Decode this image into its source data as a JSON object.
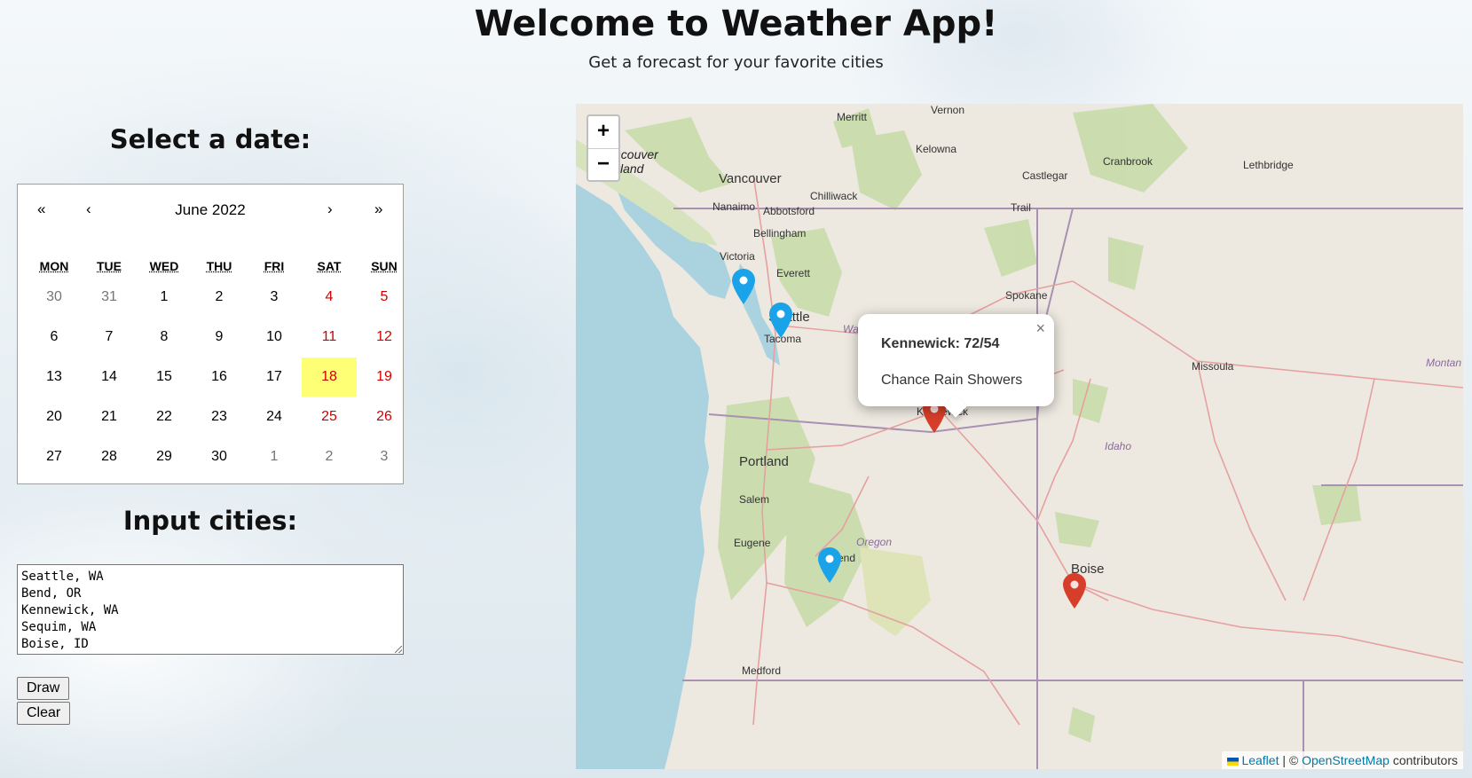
{
  "page": {
    "title": "Welcome to Weather App!",
    "subtitle": "Get a forecast for your favorite cities"
  },
  "date_section": {
    "heading": "Select a date:"
  },
  "calendar": {
    "nav_prev2": "«",
    "nav_prev": "‹",
    "nav_next": "›",
    "nav_next2": "»",
    "month_label": "June 2022",
    "weekdays": [
      "MON",
      "TUE",
      "WED",
      "THU",
      "FRI",
      "SAT",
      "SUN"
    ],
    "days": [
      [
        "30",
        "31",
        "1",
        "2",
        "3",
        "4",
        "5"
      ],
      [
        "6",
        "7",
        "8",
        "9",
        "10",
        "11",
        "12"
      ],
      [
        "13",
        "14",
        "15",
        "16",
        "17",
        "18",
        "19"
      ],
      [
        "20",
        "21",
        "22",
        "23",
        "24",
        "25",
        "26"
      ],
      [
        "27",
        "28",
        "29",
        "30",
        "1",
        "2",
        "3"
      ]
    ],
    "selected_day": "18",
    "selected_color": "#ffff76",
    "weekend_color": "#d10000"
  },
  "cities_section": {
    "heading": "Input cities:",
    "value": "Seattle, WA\nBend, OR\nKennewick, WA\nSequim, WA\nBoise, ID"
  },
  "buttons": {
    "draw": "Draw",
    "clear": "Clear"
  },
  "map": {
    "zoom_in": "+",
    "zoom_out": "−",
    "labels": {
      "vancouver_island": "ncouver\nsland",
      "vernon": "Vernon",
      "merritt": "Merritt",
      "kelowna": "Kelowna",
      "vancouver": "Vancouver",
      "nanaimo": "Nanaimo",
      "chilliwack": "Chilliwack",
      "abbotsford": "Abbotsford",
      "castlegar": "Castlegar",
      "trail": "Trail",
      "cranbrook": "Cranbrook",
      "lethbridge": "Lethbridge",
      "bellingham": "Bellingham",
      "victoria": "Victoria",
      "everett": "Everett",
      "spokane": "Spokane",
      "seattle": "Seattle",
      "tacoma": "Tacoma",
      "missoula": "Missoula",
      "montana": "Montan",
      "kennewick": "Kennewick",
      "idaho": "Idaho",
      "portland": "Portland",
      "salem": "Salem",
      "eugene": "Eugene",
      "oregon": "Oregon",
      "bend": "Bend",
      "boise": "Boise",
      "medford": "Medford",
      "washington": "Wa"
    },
    "marker_colors": {
      "blue": "#1aa3e8",
      "red": "#d63e2a"
    },
    "popup": {
      "title": "Kennewick: 72/54",
      "body": "Chance Rain Showers",
      "close": "×"
    },
    "attribution": {
      "leaflet": "Leaflet",
      "separator": " | © ",
      "osm": "OpenStreetMap",
      "suffix": " contributors"
    }
  }
}
